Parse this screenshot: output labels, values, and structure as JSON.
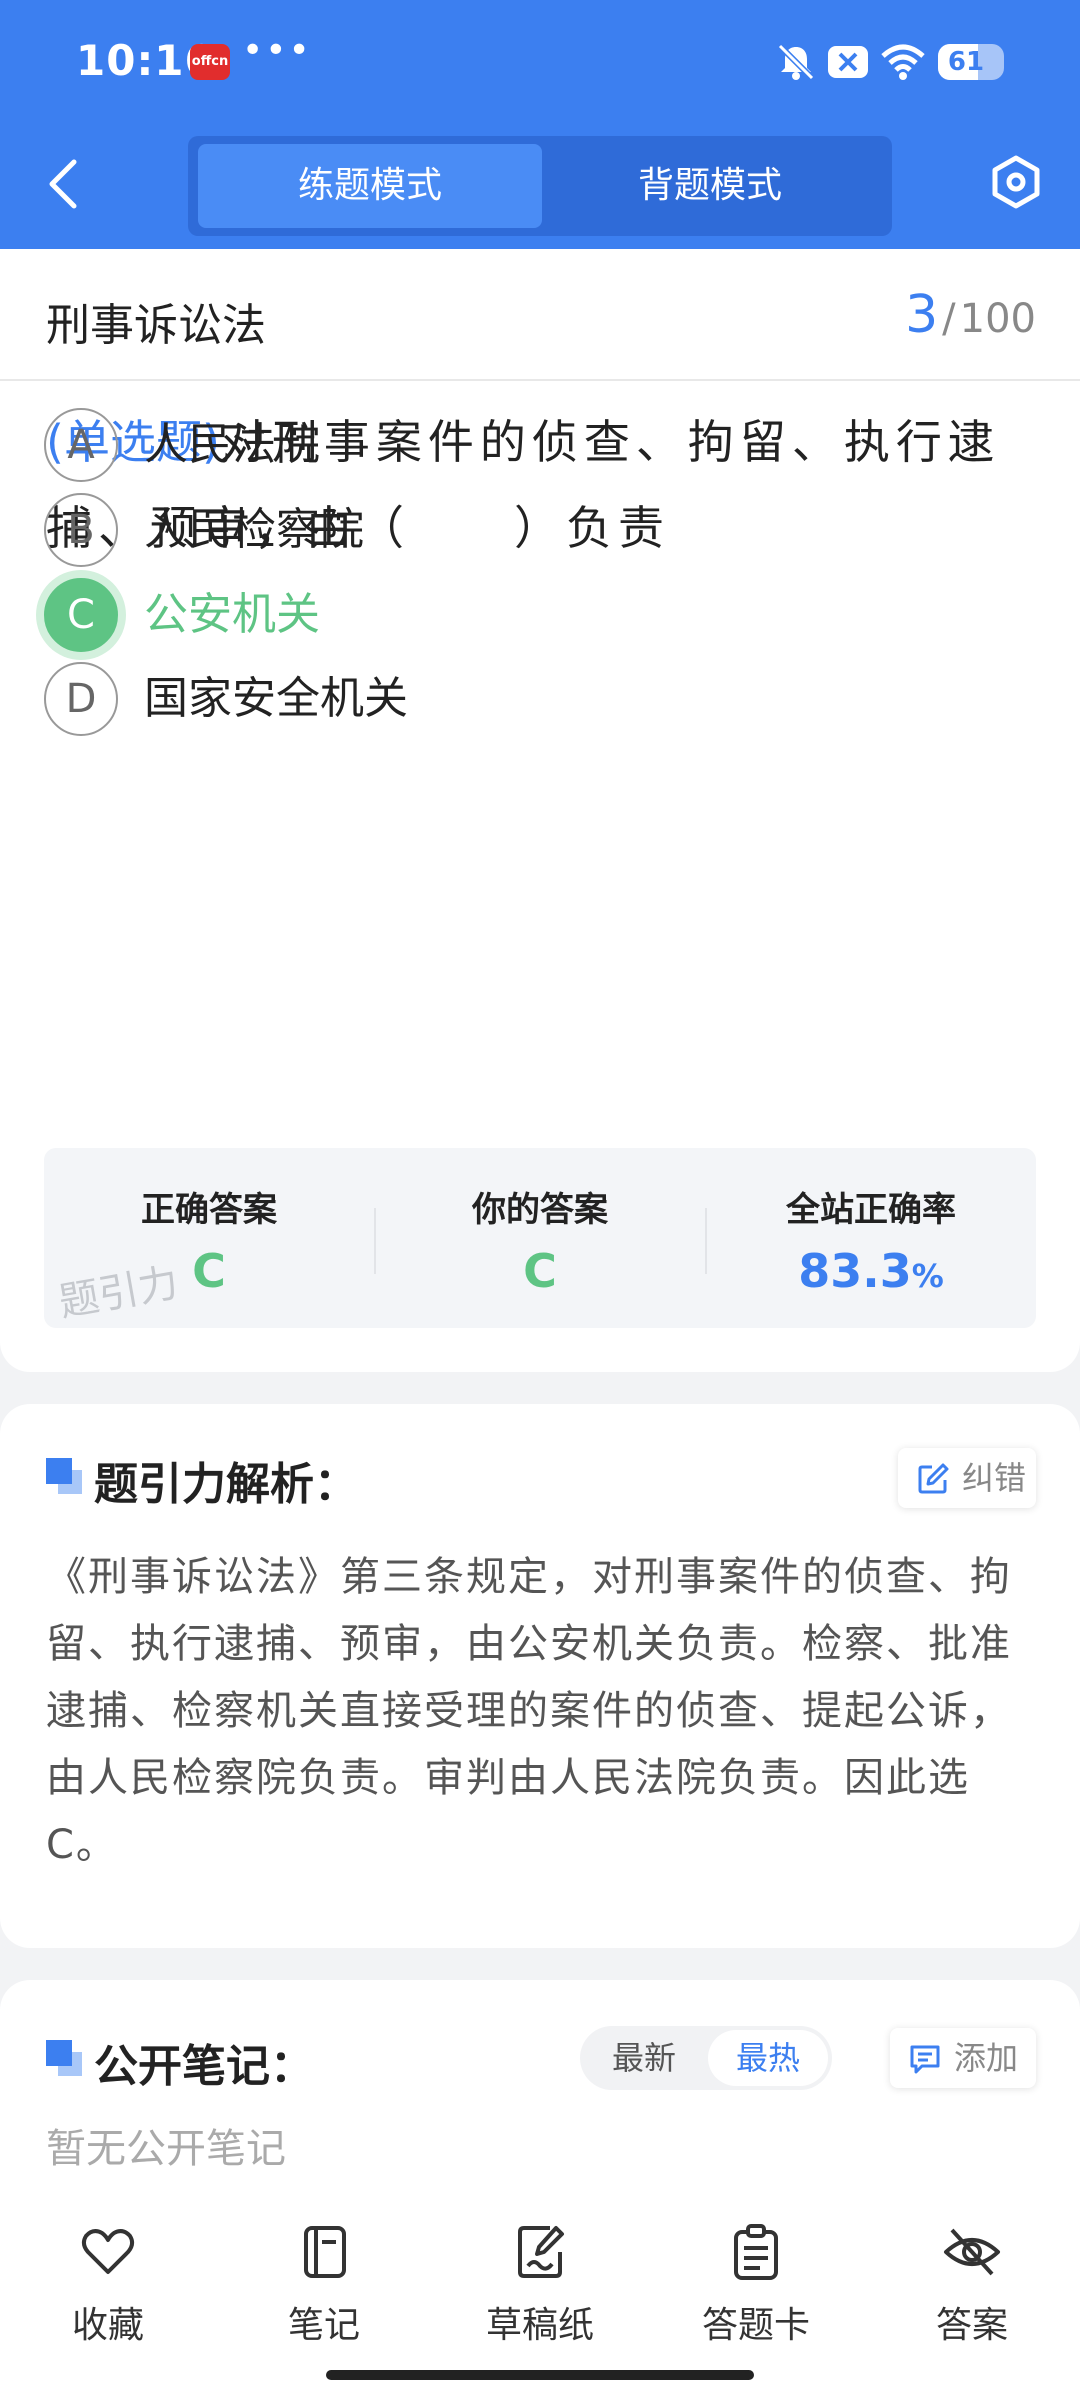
{
  "status_bar": {
    "time": "10:16",
    "app_badge": "offcn",
    "dots": "•••",
    "battery": "61",
    "battery_level": 0.61,
    "icons": [
      "bell-off-icon",
      "close-box-icon",
      "wifi-icon",
      "battery-icon"
    ]
  },
  "header": {
    "tabs": [
      {
        "label": "练题模式",
        "active": true
      },
      {
        "label": "背题模式",
        "active": false
      }
    ],
    "accent_color": "#3c7ff0"
  },
  "question": {
    "subject": "刑事诉讼法",
    "current": "3",
    "separator": "/",
    "total": "100",
    "type_label": "(单选题)",
    "text": "对刑事案件的侦查、拘留、执行逮捕、预审，由（　　）负责",
    "options": [
      {
        "letter": "A",
        "text": "人民法院",
        "correct": false
      },
      {
        "letter": "B",
        "text": "人民检察院",
        "correct": false
      },
      {
        "letter": "C",
        "text": "公安机关",
        "correct": true
      },
      {
        "letter": "D",
        "text": "国家安全机关",
        "correct": false
      }
    ],
    "correct_color": "#5ec484"
  },
  "answer_summary": {
    "correct_label": "正确答案",
    "correct_value": "C",
    "yours_label": "你的答案",
    "yours_value": "C",
    "rate_label": "全站正确率",
    "rate_value": "83.3",
    "rate_unit": "%",
    "watermark": "题引力"
  },
  "analysis": {
    "title": "题引力解析：",
    "report_button": "纠错",
    "text": "《刑事诉讼法》第三条规定，对刑事案件的侦查、拘留、执行逮捕、预审，由公安机关负责。检察、批准逮捕、检察机关直接受理的案件的侦查、提起公诉，由人民检察院负责。审判由人民法院负责。因此选C。"
  },
  "notes": {
    "title": "公开笔记：",
    "sort_newest": "最新",
    "sort_hottest": "最热",
    "add_button": "添加",
    "empty_text": "暂无公开笔记"
  },
  "toolbar": {
    "items": [
      {
        "label": "收藏",
        "icon": "heart-icon"
      },
      {
        "label": "笔记",
        "icon": "notebook-icon"
      },
      {
        "label": "草稿纸",
        "icon": "draft-icon"
      },
      {
        "label": "答题卡",
        "icon": "answer-card-icon"
      },
      {
        "label": "答案",
        "icon": "eye-off-icon"
      }
    ]
  }
}
